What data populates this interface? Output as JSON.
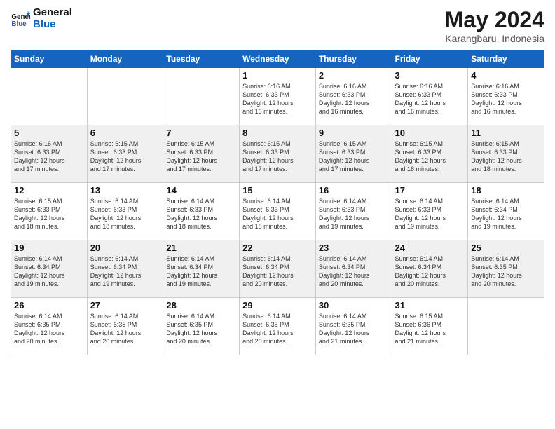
{
  "logo": {
    "line1": "General",
    "line2": "Blue"
  },
  "header": {
    "month": "May 2024",
    "location": "Karangbaru, Indonesia"
  },
  "weekdays": [
    "Sunday",
    "Monday",
    "Tuesday",
    "Wednesday",
    "Thursday",
    "Friday",
    "Saturday"
  ],
  "weeks": [
    [
      {
        "day": "",
        "info": ""
      },
      {
        "day": "",
        "info": ""
      },
      {
        "day": "",
        "info": ""
      },
      {
        "day": "1",
        "info": "Sunrise: 6:16 AM\nSunset: 6:33 PM\nDaylight: 12 hours\nand 16 minutes."
      },
      {
        "day": "2",
        "info": "Sunrise: 6:16 AM\nSunset: 6:33 PM\nDaylight: 12 hours\nand 16 minutes."
      },
      {
        "day": "3",
        "info": "Sunrise: 6:16 AM\nSunset: 6:33 PM\nDaylight: 12 hours\nand 16 minutes."
      },
      {
        "day": "4",
        "info": "Sunrise: 6:16 AM\nSunset: 6:33 PM\nDaylight: 12 hours\nand 16 minutes."
      }
    ],
    [
      {
        "day": "5",
        "info": "Sunrise: 6:16 AM\nSunset: 6:33 PM\nDaylight: 12 hours\nand 17 minutes."
      },
      {
        "day": "6",
        "info": "Sunrise: 6:15 AM\nSunset: 6:33 PM\nDaylight: 12 hours\nand 17 minutes."
      },
      {
        "day": "7",
        "info": "Sunrise: 6:15 AM\nSunset: 6:33 PM\nDaylight: 12 hours\nand 17 minutes."
      },
      {
        "day": "8",
        "info": "Sunrise: 6:15 AM\nSunset: 6:33 PM\nDaylight: 12 hours\nand 17 minutes."
      },
      {
        "day": "9",
        "info": "Sunrise: 6:15 AM\nSunset: 6:33 PM\nDaylight: 12 hours\nand 17 minutes."
      },
      {
        "day": "10",
        "info": "Sunrise: 6:15 AM\nSunset: 6:33 PM\nDaylight: 12 hours\nand 18 minutes."
      },
      {
        "day": "11",
        "info": "Sunrise: 6:15 AM\nSunset: 6:33 PM\nDaylight: 12 hours\nand 18 minutes."
      }
    ],
    [
      {
        "day": "12",
        "info": "Sunrise: 6:15 AM\nSunset: 6:33 PM\nDaylight: 12 hours\nand 18 minutes."
      },
      {
        "day": "13",
        "info": "Sunrise: 6:14 AM\nSunset: 6:33 PM\nDaylight: 12 hours\nand 18 minutes."
      },
      {
        "day": "14",
        "info": "Sunrise: 6:14 AM\nSunset: 6:33 PM\nDaylight: 12 hours\nand 18 minutes."
      },
      {
        "day": "15",
        "info": "Sunrise: 6:14 AM\nSunset: 6:33 PM\nDaylight: 12 hours\nand 18 minutes."
      },
      {
        "day": "16",
        "info": "Sunrise: 6:14 AM\nSunset: 6:33 PM\nDaylight: 12 hours\nand 19 minutes."
      },
      {
        "day": "17",
        "info": "Sunrise: 6:14 AM\nSunset: 6:33 PM\nDaylight: 12 hours\nand 19 minutes."
      },
      {
        "day": "18",
        "info": "Sunrise: 6:14 AM\nSunset: 6:34 PM\nDaylight: 12 hours\nand 19 minutes."
      }
    ],
    [
      {
        "day": "19",
        "info": "Sunrise: 6:14 AM\nSunset: 6:34 PM\nDaylight: 12 hours\nand 19 minutes."
      },
      {
        "day": "20",
        "info": "Sunrise: 6:14 AM\nSunset: 6:34 PM\nDaylight: 12 hours\nand 19 minutes."
      },
      {
        "day": "21",
        "info": "Sunrise: 6:14 AM\nSunset: 6:34 PM\nDaylight: 12 hours\nand 19 minutes."
      },
      {
        "day": "22",
        "info": "Sunrise: 6:14 AM\nSunset: 6:34 PM\nDaylight: 12 hours\nand 20 minutes."
      },
      {
        "day": "23",
        "info": "Sunrise: 6:14 AM\nSunset: 6:34 PM\nDaylight: 12 hours\nand 20 minutes."
      },
      {
        "day": "24",
        "info": "Sunrise: 6:14 AM\nSunset: 6:34 PM\nDaylight: 12 hours\nand 20 minutes."
      },
      {
        "day": "25",
        "info": "Sunrise: 6:14 AM\nSunset: 6:35 PM\nDaylight: 12 hours\nand 20 minutes."
      }
    ],
    [
      {
        "day": "26",
        "info": "Sunrise: 6:14 AM\nSunset: 6:35 PM\nDaylight: 12 hours\nand 20 minutes."
      },
      {
        "day": "27",
        "info": "Sunrise: 6:14 AM\nSunset: 6:35 PM\nDaylight: 12 hours\nand 20 minutes."
      },
      {
        "day": "28",
        "info": "Sunrise: 6:14 AM\nSunset: 6:35 PM\nDaylight: 12 hours\nand 20 minutes."
      },
      {
        "day": "29",
        "info": "Sunrise: 6:14 AM\nSunset: 6:35 PM\nDaylight: 12 hours\nand 20 minutes."
      },
      {
        "day": "30",
        "info": "Sunrise: 6:14 AM\nSunset: 6:35 PM\nDaylight: 12 hours\nand 21 minutes."
      },
      {
        "day": "31",
        "info": "Sunrise: 6:15 AM\nSunset: 6:36 PM\nDaylight: 12 hours\nand 21 minutes."
      },
      {
        "day": "",
        "info": ""
      }
    ]
  ]
}
